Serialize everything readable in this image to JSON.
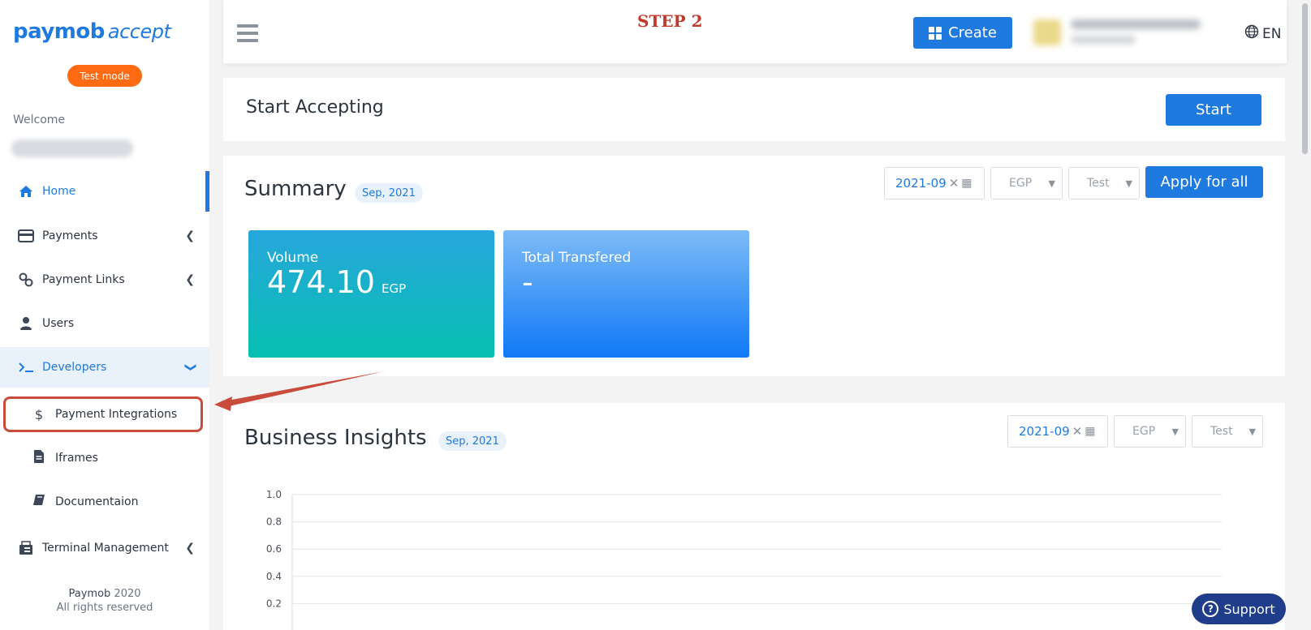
{
  "brand": {
    "name": "paymob",
    "product": "accept"
  },
  "sidebar": {
    "test_mode": "Test mode",
    "welcome": "Welcome",
    "items": [
      {
        "label": "Home",
        "icon": "home-icon"
      },
      {
        "label": "Payments",
        "icon": "credit-card-icon"
      },
      {
        "label": "Payment Links",
        "icon": "link-icon"
      },
      {
        "label": "Users",
        "icon": "user-icon"
      },
      {
        "label": "Developers",
        "icon": "terminal-icon"
      },
      {
        "label": "Terminal Management",
        "icon": "fax-icon"
      }
    ],
    "sub_items": [
      {
        "label": "Payment Integrations",
        "icon": "dollar-icon"
      },
      {
        "label": "Iframes",
        "icon": "file-icon"
      },
      {
        "label": "Documentaion",
        "icon": "book-icon"
      }
    ],
    "footer": {
      "brand": "Paymob",
      "year": "2020",
      "rights": "All rights reserved"
    }
  },
  "topbar": {
    "step_label": "STEP 2",
    "create_label": "Create",
    "language": "EN"
  },
  "start_card": {
    "title": "Start Accepting",
    "button": "Start"
  },
  "summary": {
    "title": "Summary",
    "badge": "Sep, 2021",
    "date_value": "2021-09",
    "currency": "EGP",
    "mode": "Test",
    "apply_label": "Apply for all",
    "volume": {
      "label": "Volume",
      "value": "474.10",
      "unit": "EGP"
    },
    "transferred": {
      "label": "Total Transfered",
      "value": "-"
    }
  },
  "insights": {
    "title": "Business Insights",
    "badge": "Sep, 2021",
    "date_value": "2021-09",
    "currency": "EGP",
    "mode": "Test"
  },
  "chart_data": {
    "type": "line",
    "y_ticks": [
      "1.0",
      "0.8",
      "0.6",
      "0.4",
      "0.2"
    ],
    "ylim": [
      0,
      1.0
    ],
    "series": []
  },
  "support_label": "Support",
  "colors": {
    "primary": "#1f7ae0",
    "test_mode": "#ff6a13",
    "annotation": "#c84b3b"
  }
}
